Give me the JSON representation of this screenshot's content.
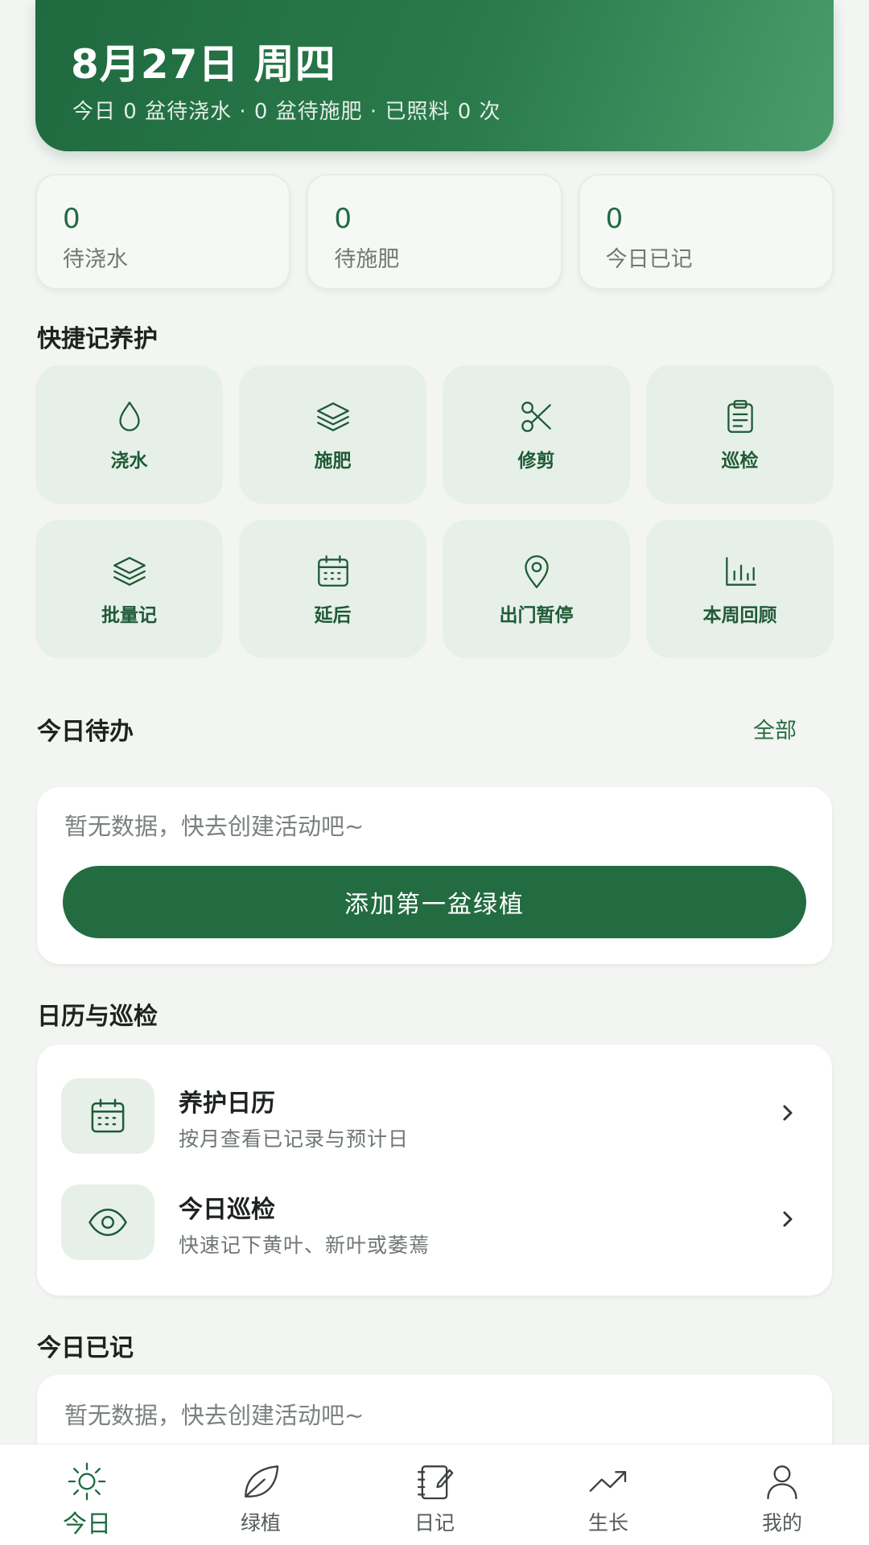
{
  "header": {
    "date": "8月27日 周四",
    "summary": "今日 0 盆待浇水 · 0 盆待施肥 · 已照料 0 次"
  },
  "stats": [
    {
      "value": "0",
      "label": "待浇水"
    },
    {
      "value": "0",
      "label": "待施肥"
    },
    {
      "value": "0",
      "label": "今日已记"
    }
  ],
  "quick": {
    "title": "快捷记养护",
    "items": [
      {
        "label": "浇水",
        "icon": "water-drop-icon"
      },
      {
        "label": "施肥",
        "icon": "layers-icon"
      },
      {
        "label": "修剪",
        "icon": "scissors-icon"
      },
      {
        "label": "巡检",
        "icon": "clipboard-icon"
      },
      {
        "label": "批量记",
        "icon": "stack-icon"
      },
      {
        "label": "延后",
        "icon": "calendar-icon"
      },
      {
        "label": "出门暂停",
        "icon": "location-pin-icon"
      },
      {
        "label": "本周回顾",
        "icon": "bar-chart-icon"
      }
    ]
  },
  "todo": {
    "title": "今日待办",
    "all_link": "全部",
    "empty_text": "暂无数据，快去创建活动吧~",
    "add_button": "添加第一盆绿植"
  },
  "calendar_section": {
    "title": "日历与巡检",
    "rows": [
      {
        "title": "养护日历",
        "subtitle": "按月查看已记录与预计日",
        "icon": "calendar-icon"
      },
      {
        "title": "今日巡检",
        "subtitle": "快速记下黄叶、新叶或萎蔫",
        "icon": "eye-icon"
      }
    ]
  },
  "recorded": {
    "title": "今日已记",
    "empty_text": "暂无数据，快去创建活动吧~"
  },
  "nav": [
    {
      "label": "今日",
      "icon": "sun-icon",
      "active": true
    },
    {
      "label": "绿植",
      "icon": "leaf-icon",
      "active": false
    },
    {
      "label": "日记",
      "icon": "notebook-icon",
      "active": false
    },
    {
      "label": "生长",
      "icon": "trending-up-icon",
      "active": false
    },
    {
      "label": "我的",
      "icon": "user-icon",
      "active": false
    }
  ],
  "colors": {
    "primary": "#236b41",
    "tile_bg": "#e6f0e8",
    "background": "#f3f5f2"
  }
}
